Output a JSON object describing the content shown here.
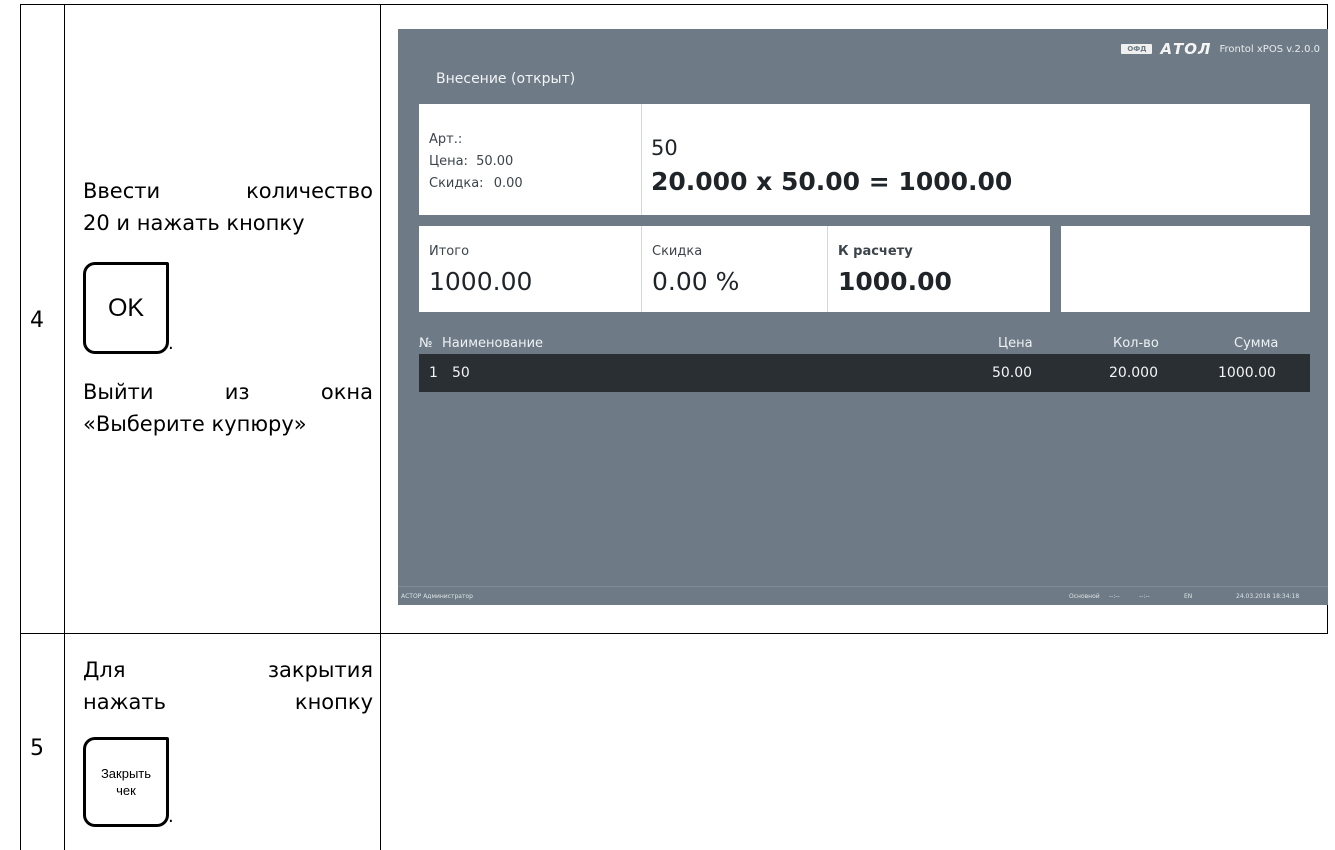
{
  "rows": [
    {
      "number": "4",
      "instruction_parts": {
        "line1_a": "Ввести",
        "line1_b": "количество",
        "line2": "20 и нажать кнопку",
        "key_label": "OK",
        "after_key": ".",
        "line3_a": "Выйти",
        "line3_b": "из",
        "line3_c": "окна",
        "line4": "«Выберите купюру»"
      }
    },
    {
      "number": "5",
      "instruction_parts": {
        "line1_a": "Для",
        "line1_b": "закрытия",
        "line2_a": "нажать",
        "line2_b": "кнопку",
        "key_line1": "Закрыть",
        "key_line2": "чек",
        "after_key": "."
      }
    }
  ],
  "pos": {
    "title": "Внесение (открыт)",
    "brand": {
      "ofd": "ОФД",
      "logo": "АТОЛ",
      "version": "Frontol xPOS v.2.0.0"
    },
    "item": {
      "art_label": "Арт.:",
      "price_label": "Цена:",
      "price_value": "50.00",
      "discount_label": "Скидка:",
      "discount_value": "0.00",
      "name": "50",
      "calc": "20.000 x 50.00 = 1000.00"
    },
    "totals": {
      "total_label": "Итого",
      "total_value": "1000.00",
      "discount_label": "Скидка",
      "discount_value": "0.00 %",
      "due_label": "К расчету",
      "due_value": "1000.00"
    },
    "list": {
      "headers": {
        "num": "№",
        "name": "Наименование",
        "price": "Цена",
        "qty": "Кол-во",
        "sum": "Сумма"
      },
      "rows": [
        {
          "num": "1",
          "name": "50",
          "price": "50.00",
          "qty": "20.000",
          "sum": "1000.00"
        }
      ]
    },
    "status": {
      "user": "АСТОР Администратор",
      "mode": "Основной",
      "f1": "--:--",
      "f2": "--:--",
      "lang": "EN",
      "datetime": "24.03.2018 18:34:18"
    },
    "colors": {
      "background": "#6e7b86",
      "selected_row": "#2a2f33",
      "card": "#ffffff"
    }
  }
}
